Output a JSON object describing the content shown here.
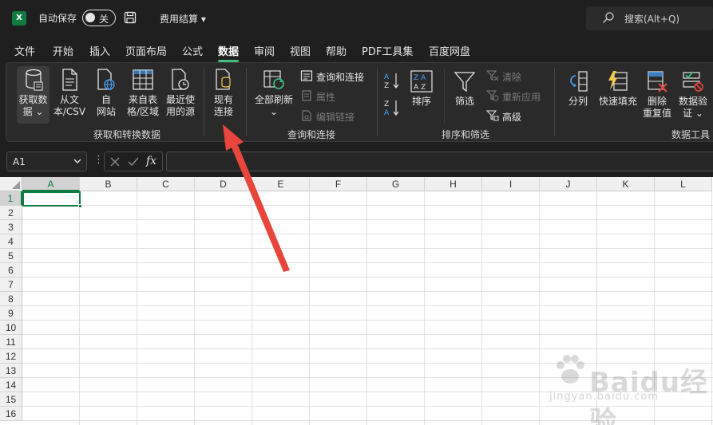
{
  "titlebar": {
    "app_logo": "X",
    "autosave_label": "自动保存",
    "autosave_state": "关",
    "doc_title": "费用结算",
    "search_text": "搜索(Alt+Q)"
  },
  "tabs": [
    {
      "label": "文件",
      "active": false
    },
    {
      "label": "开始",
      "active": false
    },
    {
      "label": "插入",
      "active": false
    },
    {
      "label": "页面布局",
      "active": false
    },
    {
      "label": "公式",
      "active": false
    },
    {
      "label": "数据",
      "active": true
    },
    {
      "label": "审阅",
      "active": false
    },
    {
      "label": "视图",
      "active": false
    },
    {
      "label": "帮助",
      "active": false
    },
    {
      "label": "PDF工具集",
      "active": false
    },
    {
      "label": "百度网盘",
      "active": false
    }
  ],
  "ribbon": {
    "get_data": {
      "line1": "获取数",
      "line2": "据 ⌄"
    },
    "from_text": {
      "line1": "从文",
      "line2": "本/CSV"
    },
    "from_web": {
      "line1": "自",
      "line2": "网站"
    },
    "from_table": {
      "line1": "来自表",
      "line2": "格/区域"
    },
    "recent_sources": {
      "line1": "最近使",
      "line2": "用的源"
    },
    "existing_conn": {
      "line1": "现有",
      "line2": "连接"
    },
    "group_get_transform": "获取和转换数据",
    "refresh_all": {
      "line1": "全部刷新",
      "line2": "⌄"
    },
    "queries_connections": "查询和连接",
    "properties": "属性",
    "edit_links": "编辑链接",
    "group_queries": "查询和连接",
    "sort": "排序",
    "filter": "筛选",
    "clear": "清除",
    "reapply": "重新应用",
    "advanced": "高级",
    "group_sort_filter": "排序和筛选",
    "text_to_columns": "分列",
    "flash_fill": "快速填充",
    "remove_dup": {
      "line1": "删除",
      "line2": "重复值"
    },
    "data_validation": {
      "line1": "数据验",
      "line2": "证 ⌄"
    },
    "group_data_tools": "数据工具"
  },
  "formula_bar": {
    "name_box": "A1",
    "fx_label": "fx",
    "formula": ""
  },
  "sheet": {
    "columns": [
      "A",
      "B",
      "C",
      "D",
      "E",
      "F",
      "G",
      "H",
      "I",
      "J",
      "K",
      "L"
    ],
    "rows": [
      "1",
      "2",
      "3",
      "4",
      "5",
      "6",
      "7",
      "8",
      "9",
      "10",
      "11",
      "12",
      "13",
      "14",
      "15",
      "16"
    ],
    "active_cell": "A1"
  },
  "watermark": {
    "text": "Baidu经验",
    "sub": "jingyan.baidu.com"
  },
  "colors": {
    "excel_green": "#107c41",
    "arrow_red": "#e8463c",
    "tab_underline": "#3fbf7f"
  }
}
